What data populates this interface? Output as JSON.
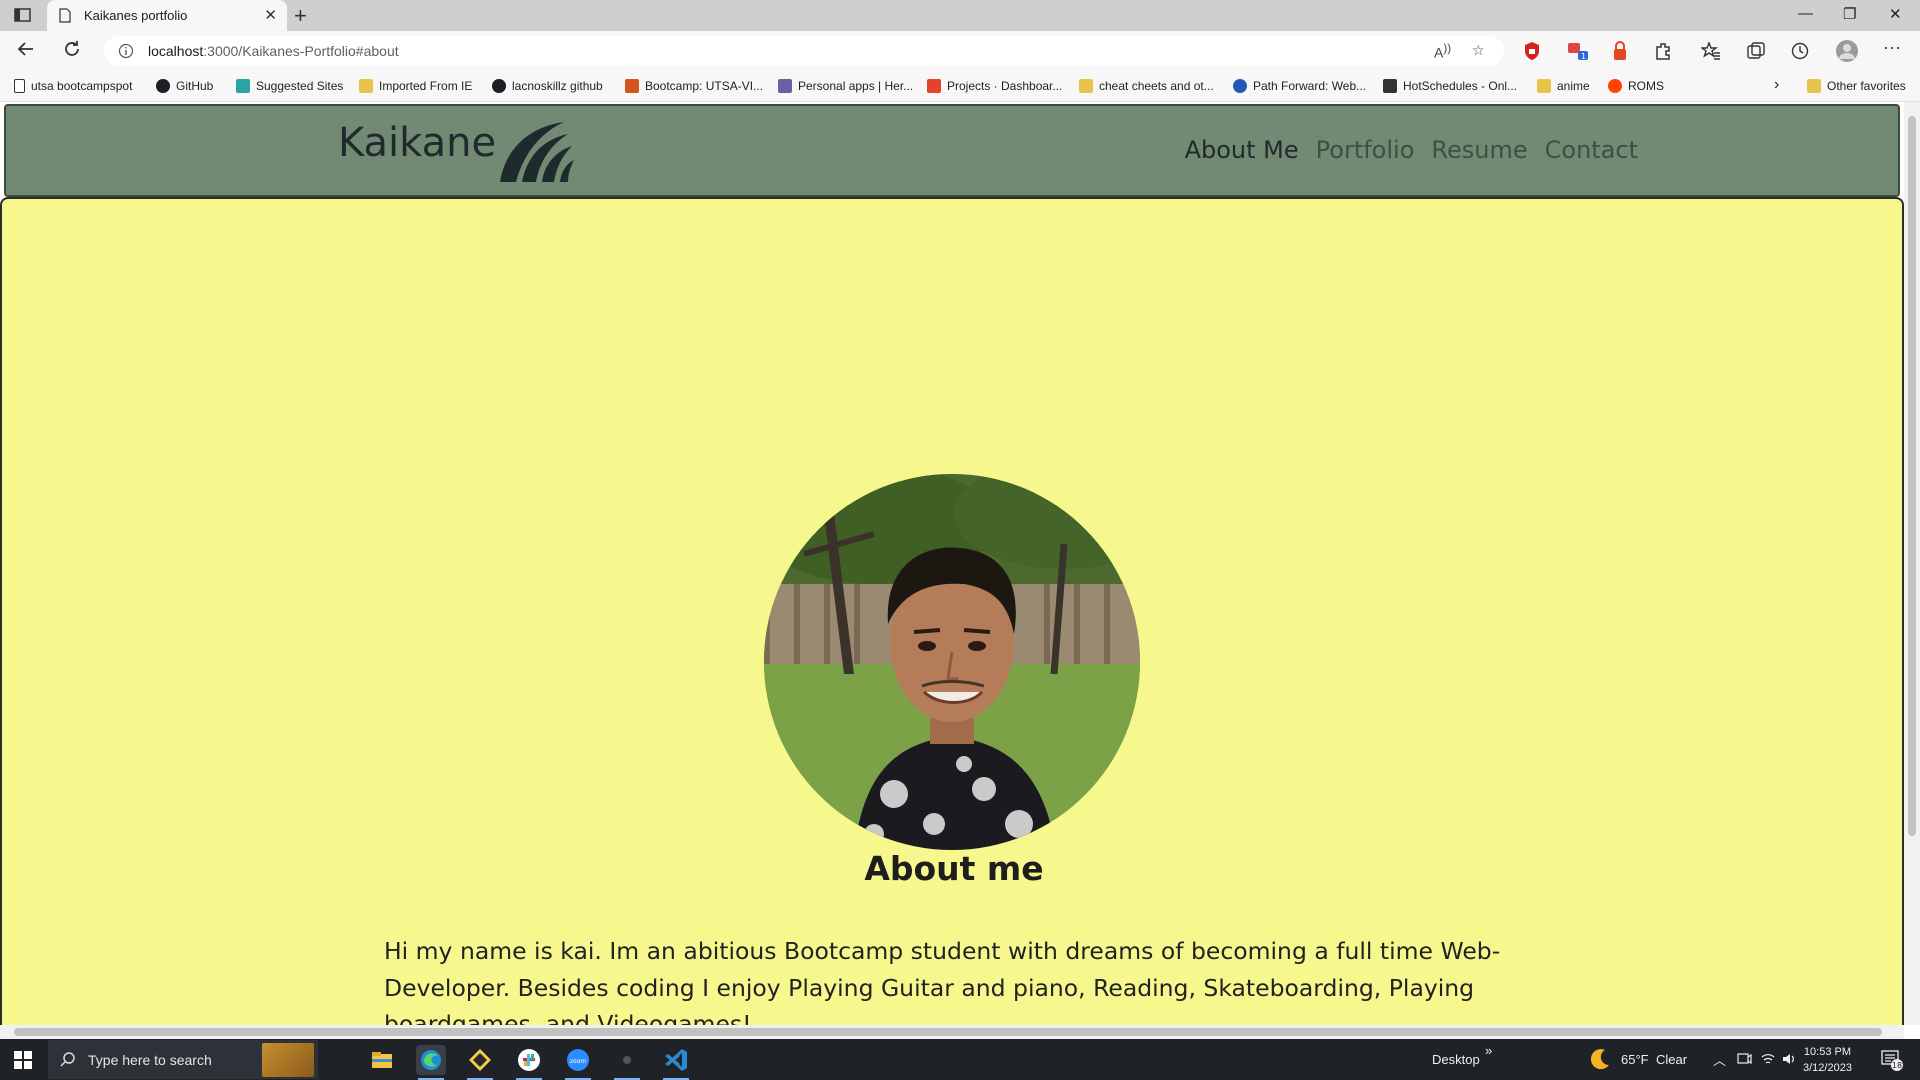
{
  "browser": {
    "tab_title": "Kaikanes portfolio",
    "address_host": "localhost",
    "address_rest": ":3000/Kaikanes-Portfolio#about",
    "new_tab": "+",
    "tab_close": "✕"
  },
  "favorites": [
    {
      "label": "utsa bootcampspot",
      "icon": "page-icon",
      "color": "#ffffff"
    },
    {
      "label": "GitHub",
      "icon": "github-icon",
      "color": "#1b1f23"
    },
    {
      "label": "Suggested Sites",
      "icon": "bing-icon",
      "color": "#2aa3a3"
    },
    {
      "label": "Imported From IE",
      "icon": "folder-icon",
      "color": "#e8c34b"
    },
    {
      "label": "lacnoskillz github",
      "icon": "github-icon",
      "color": "#1b1f23"
    },
    {
      "label": "Bootcamp: UTSA-VI...",
      "icon": "utsa-icon",
      "color": "#d3541d"
    },
    {
      "label": "Personal apps | Her...",
      "icon": "heroku-icon",
      "color": "#6762a6"
    },
    {
      "label": "Projects · Dashboar...",
      "icon": "gitlab-icon",
      "color": "#e2432a"
    },
    {
      "label": "cheat cheets and ot...",
      "icon": "folder-icon",
      "color": "#e8c34b"
    },
    {
      "label": "Path Forward: Web...",
      "icon": "edx-icon",
      "color": "#2457b8"
    },
    {
      "label": "HotSchedules - Onl...",
      "icon": "hotschedules-icon",
      "color": "#333333"
    },
    {
      "label": "anime",
      "icon": "folder-anime-icon",
      "color": "#e8c34b"
    },
    {
      "label": "ROMS",
      "icon": "reddit-icon",
      "color": "#ff4500"
    }
  ],
  "favorites_overflow": "›",
  "other_favorites": "Other favorites",
  "site": {
    "brand": "Kaikane",
    "nav": [
      {
        "label": "About Me",
        "active": true
      },
      {
        "label": "Portfolio",
        "active": false
      },
      {
        "label": "Resume",
        "active": false
      },
      {
        "label": "Contact",
        "active": false
      }
    ],
    "about_heading": "About me",
    "about_text": "Hi my name is kai. Im an abitious Bootcamp student with dreams of becoming a full time Web-Developer. Besides coding I enjoy Playing Guitar and piano, Reading, Skateboarding, Playing boardgames, and Videogames!"
  },
  "colors": {
    "header_bg": "#728a74",
    "about_bg": "#f6f88e"
  },
  "taskbar": {
    "search_placeholder": "Type here to search",
    "desktop_label": "Desktop",
    "desktop_chevron": "»",
    "weather_temp": "65°F",
    "weather_desc": "Clear",
    "time": "10:53 PM",
    "date": "3/12/2023",
    "notifications": "18"
  }
}
